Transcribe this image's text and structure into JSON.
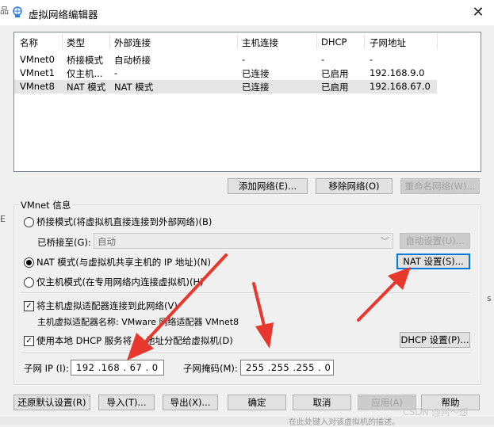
{
  "window": {
    "title": "虚拟网络编辑器",
    "left_edge_text": [
      "品",
      "E"
    ],
    "right_edge_text": "s"
  },
  "network_list": {
    "columns": [
      "名称",
      "类型",
      "外部连接",
      "主机连接",
      "DHCP",
      "子网地址"
    ],
    "rows": [
      [
        "VMnet0",
        "桥接模式",
        "自动桥接",
        "-",
        "-",
        "-"
      ],
      [
        "VMnet1",
        "仅主机...",
        "-",
        "已连接",
        "已启用",
        "192.168.9.0"
      ],
      [
        "VMnet8",
        "NAT 模式",
        "NAT 模式",
        "已连接",
        "已启用",
        "192.168.67.0"
      ]
    ],
    "selected_row": 2
  },
  "list_buttons": {
    "add": "添加网络(E)...",
    "remove": "移除网络(O)",
    "rename": "重命名网络(W)..."
  },
  "vmnet_info": {
    "group_title": "VMnet 信息",
    "bridged_radio": "桥接模式(将虚拟机直接连接到外部网络)(B)",
    "bridged_to_label": "已桥接至(G):",
    "bridged_to_value": "自动",
    "auto_settings": "自动设置(U)...",
    "nat_radio": "NAT 模式(与虚拟机共享主机的 IP 地址)(N)",
    "nat_settings": "NAT 设置(S)...",
    "hostonly_radio": "仅主机模式(在专用网络内连接虚拟机)(H)",
    "selected_mode": "nat",
    "connect_adapter_checkbox": "将主机虚拟适配器连接到此网络(V)",
    "connect_adapter_checked": true,
    "adapter_name_line": "主机虚拟适配器名称: VMware 网络适配器 VMnet8",
    "dhcp_checkbox": "使用本地 DHCP 服务将 IP 地址分配给虚拟机(D)",
    "dhcp_checked": true,
    "dhcp_settings": "DHCP 设置(P)...",
    "subnet_ip_label": "子网 IP (I):",
    "subnet_ip_value": "192 .168 . 67 . 0",
    "subnet_mask_label": "子网掩码(M):",
    "subnet_mask_value": "255 .255 .255 . 0"
  },
  "bottom_buttons": {
    "restore_defaults": "还原默认设置(R)",
    "import": "导入(T)...",
    "export": "导出(X)...",
    "ok": "确定",
    "cancel": "取消",
    "apply": "应用(A)",
    "help": "帮助"
  },
  "background": {
    "watermark": "CSDN @阿～想",
    "bottom_strip_text": "在此处键入对该虚拟机的描述。"
  },
  "colors": {
    "annotation_arrow": "#e8372c",
    "focus_border": "#0078d7",
    "selected_row": "#e5e5e5"
  }
}
